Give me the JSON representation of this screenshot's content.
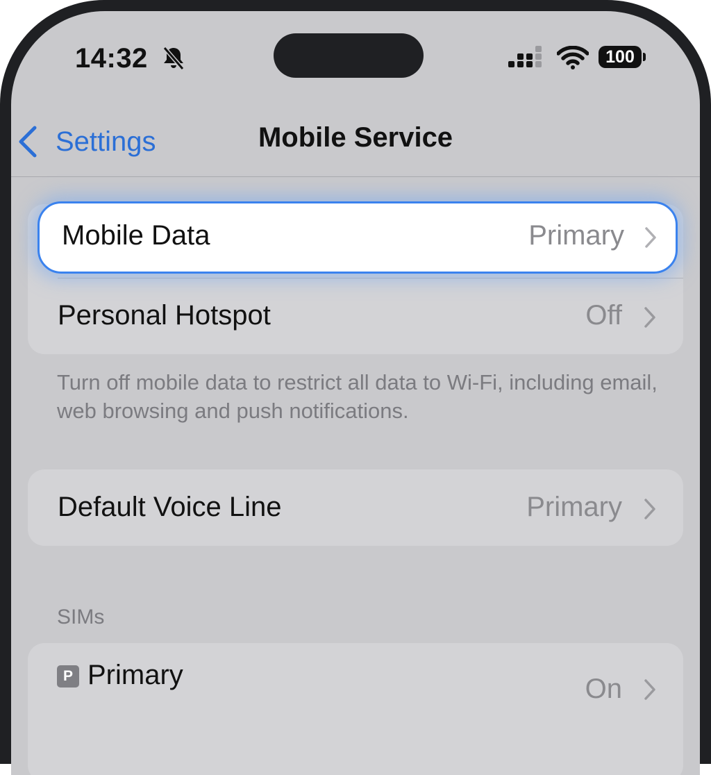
{
  "status_bar": {
    "time": "14:32",
    "battery": "100",
    "icons": [
      "bell-slash-icon",
      "cellular-signal-icon",
      "wifi-icon",
      "battery-icon"
    ]
  },
  "nav": {
    "back_label": "Settings",
    "title": "Mobile Service"
  },
  "group1": {
    "rows": [
      {
        "label": "Mobile Data",
        "value": "Primary"
      },
      {
        "label": "Personal Hotspot",
        "value": "Off"
      }
    ],
    "footer": "Turn off mobile data to restrict all data to Wi-Fi, including email, web browsing and push notifications."
  },
  "group2": {
    "rows": [
      {
        "label": "Default Voice Line",
        "value": "Primary"
      }
    ]
  },
  "sims": {
    "header": "SIMs",
    "rows": [
      {
        "badge": "P",
        "label": "Primary",
        "value": "On"
      }
    ]
  },
  "colors": {
    "accent": "#2b6fd6",
    "highlight_border": "#3a82ee",
    "frame": "#1f2023"
  }
}
